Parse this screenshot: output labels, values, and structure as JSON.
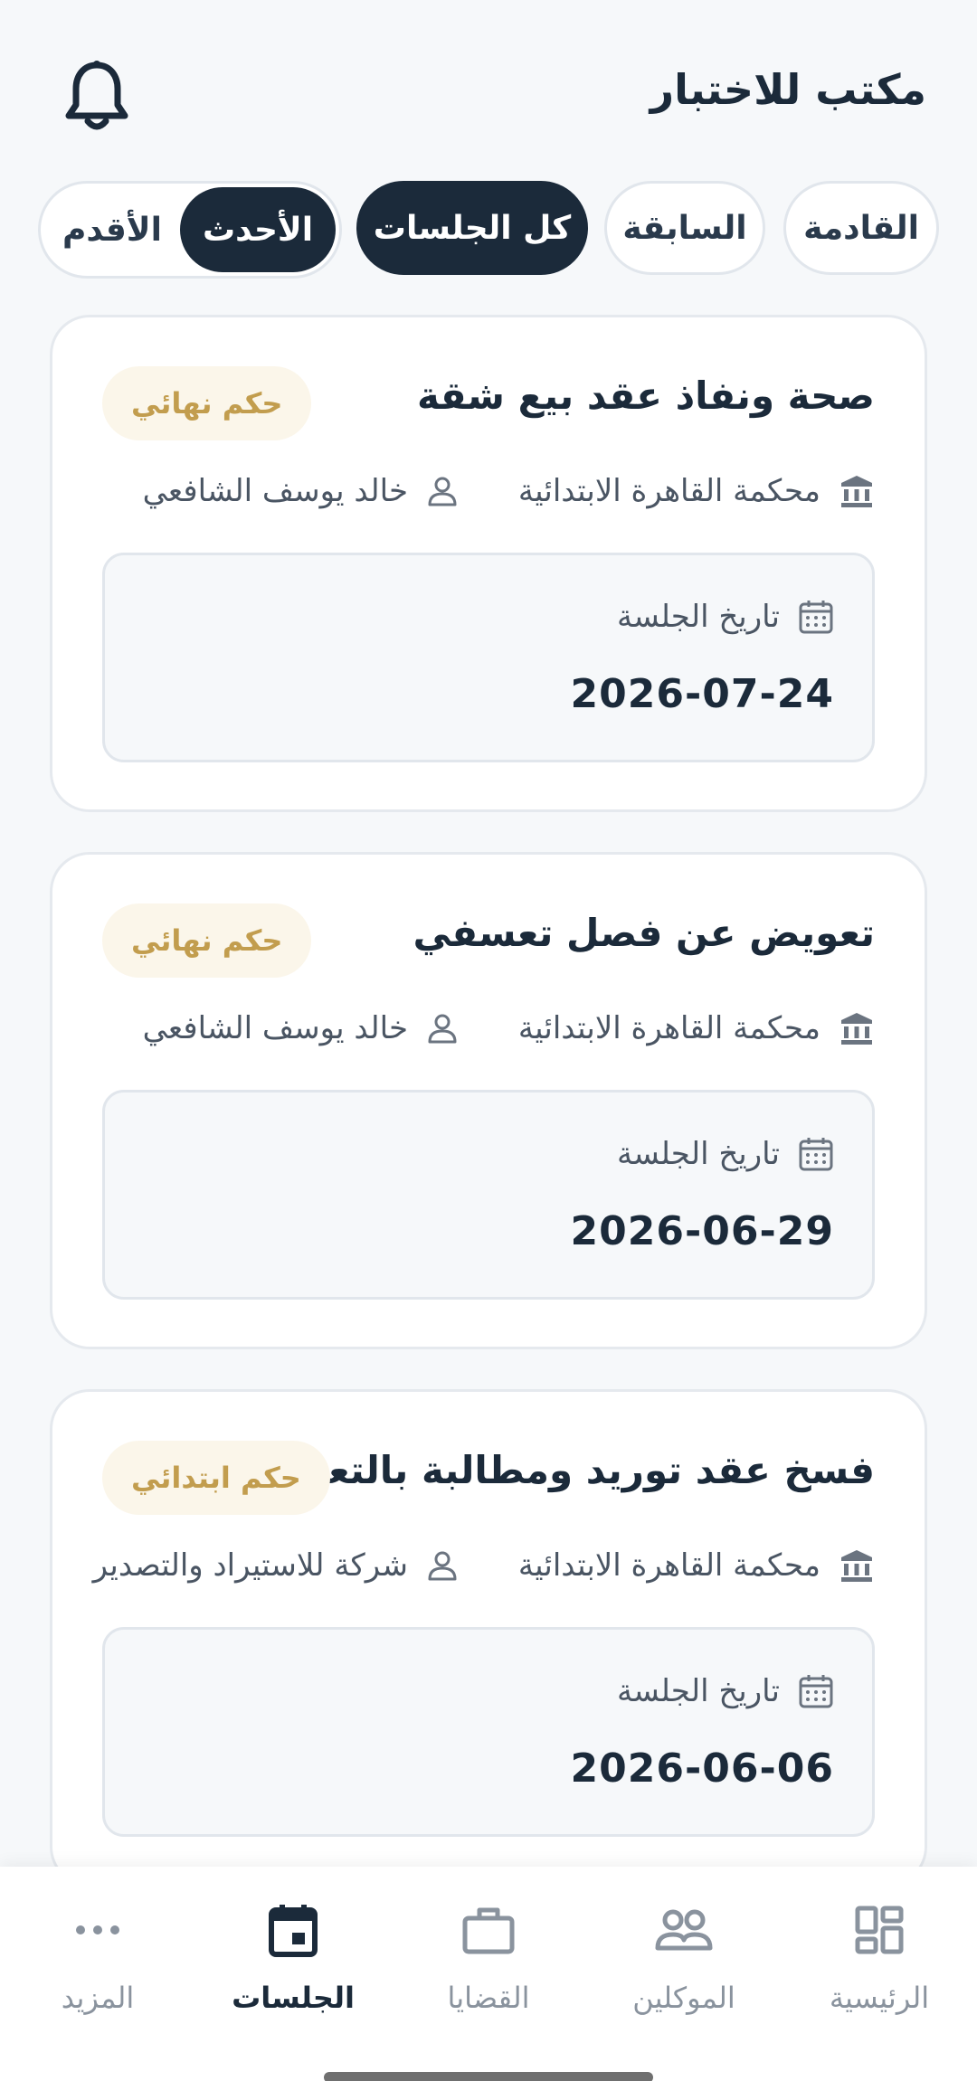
{
  "header": {
    "title": "مكتب للاختبار",
    "bell_icon": "bell-icon"
  },
  "filters": {
    "tabs": [
      {
        "label": "القادمة",
        "active": false
      },
      {
        "label": "السابقة",
        "active": false
      },
      {
        "label": "كل الجلسات",
        "active": true
      }
    ],
    "sort": [
      {
        "label": "الأحدث",
        "active": true
      },
      {
        "label": "الأقدم",
        "active": false
      }
    ]
  },
  "sessions": [
    {
      "title": "صحة ونفاذ عقد بيع شقة",
      "badge": "حكم نهائي",
      "court": "محكمة القاهرة الابتدائية",
      "client": "خالد يوسف الشافعي",
      "date_label": "تاريخ الجلسة",
      "date": "2026-07-24"
    },
    {
      "title": "تعويض عن فصل تعسفي",
      "badge": "حكم نهائي",
      "court": "محكمة القاهرة الابتدائية",
      "client": "خالد يوسف الشافعي",
      "date_label": "تاريخ الجلسة",
      "date": "2026-06-29"
    },
    {
      "title": "فسخ عقد توريد ومطالبة بالتعويض",
      "badge": "حكم ابتدائي",
      "court": "محكمة القاهرة الابتدائية",
      "client": "شركة للاستيراد والتصدير",
      "date_label": "تاريخ الجلسة",
      "date": "2026-06-06"
    }
  ],
  "bottom_nav": [
    {
      "label": "الرئيسية",
      "icon": "dashboard-icon",
      "active": false
    },
    {
      "label": "الموكلين",
      "icon": "people-icon",
      "active": false
    },
    {
      "label": "القضايا",
      "icon": "briefcase-icon",
      "active": false
    },
    {
      "label": "الجلسات",
      "icon": "calendar-icon",
      "active": true
    },
    {
      "label": "المزيد",
      "icon": "more-icon",
      "active": false
    }
  ],
  "colors": {
    "primary": "#1b2a3a",
    "badge_bg": "#fbf6ea",
    "badge_text": "#c29d4e",
    "background": "#f6f8fa"
  }
}
